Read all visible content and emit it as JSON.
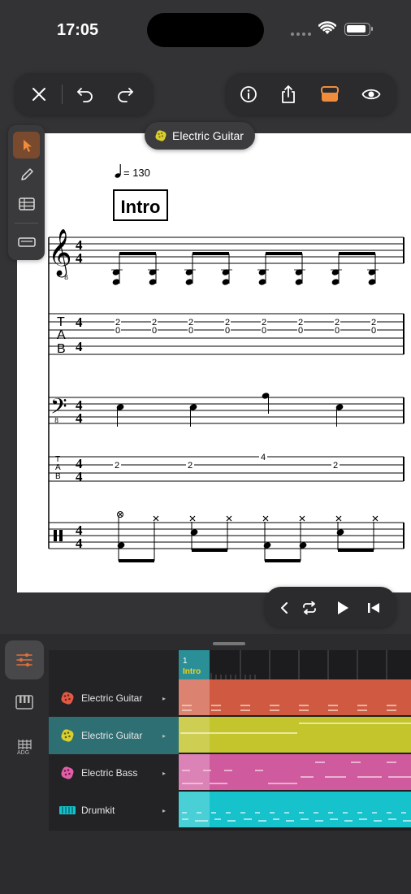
{
  "status": {
    "time": "17:05"
  },
  "score": {
    "track_badge": "Electric Guitar",
    "tempo": "= 130",
    "section": "Intro",
    "guitar_tab": [
      "2",
      "0"
    ],
    "bass_tab": [
      "2",
      "2",
      "4",
      "2"
    ]
  },
  "timeline": {
    "bar_number": "1",
    "section_label": "Intro"
  },
  "tracks": [
    {
      "name": "Electric Guitar",
      "color": "#d9573b"
    },
    {
      "name": "Electric Guitar",
      "color": "#c8c82a"
    },
    {
      "name": "Electric Bass",
      "color": "#d65aa0"
    },
    {
      "name": "Drumkit",
      "color": "#13c2cc"
    }
  ],
  "colors": {
    "accent": "#f08c3c",
    "selection": "#2e6f73"
  }
}
